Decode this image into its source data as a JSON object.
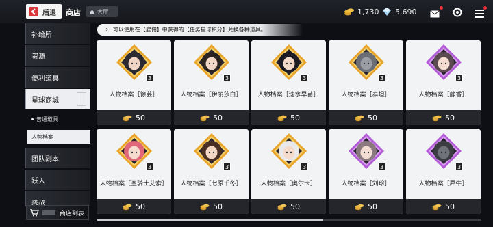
{
  "header": {
    "back_label": "后退",
    "title": "商店",
    "breadcrumb": "大厅",
    "currency_gold": "1,730",
    "currency_crystal": "5,690"
  },
  "sidebar": {
    "items": [
      {
        "label": "补给所"
      },
      {
        "label": "资源"
      },
      {
        "label": "便利道具"
      },
      {
        "label": "星球商城"
      },
      {
        "label": "团队副本"
      },
      {
        "label": "跃入"
      },
      {
        "label": "挑战"
      }
    ],
    "subitems": [
      {
        "label": "普通道具"
      },
      {
        "label": "人物档案"
      }
    ],
    "shop_list_label": "商店列表"
  },
  "notice": "可以使用在【雇佣】中获得的【任务星球积分】兑换各种道具。",
  "colors": {
    "gold_frame": "#e8a42a",
    "purple_frame": "#b35ad6",
    "card_bg": "#f2f3f5",
    "price_bar": "#24262b"
  },
  "products": [
    {
      "name": "人物档案［徐芸］",
      "price": "50",
      "count": "3",
      "rarity": "gold",
      "hair": "#2b2a30",
      "skin": "#f1d5c4"
    },
    {
      "name": "人物档案［伊丽莎白］",
      "price": "50",
      "count": "3",
      "rarity": "gold",
      "hair": "#2a2320",
      "skin": "#f2d7c6"
    },
    {
      "name": "人物档案［速水早苗］",
      "price": "50",
      "count": "3",
      "rarity": "gold",
      "hair": "#1c1a22",
      "skin": "#f3dacb"
    },
    {
      "name": "人物档案［泰坦］",
      "price": "50",
      "count": "3",
      "rarity": "gold",
      "hair": "#6b6e74",
      "skin": "#9a9da3"
    },
    {
      "name": "人物档案［静香］",
      "price": "50",
      "count": "3",
      "rarity": "purple",
      "hair": "#5b4a4f",
      "skin": "#f4dcd0"
    },
    {
      "name": "人物档案［圣骑士艾索］",
      "price": "50",
      "count": "3",
      "rarity": "gold",
      "hair": "#e0667a",
      "skin": "#f6dccf"
    },
    {
      "name": "人物档案［七原千冬］",
      "price": "50",
      "count": "3",
      "rarity": "gold",
      "hair": "#4a2f24",
      "skin": "#f2d5c2"
    },
    {
      "name": "人物档案［奥尔卡］",
      "price": "50",
      "count": "3",
      "rarity": "gold",
      "hair": "#e9e9ec",
      "skin": "#f4dbcc"
    },
    {
      "name": "人物档案［刘珍］",
      "price": "50",
      "count": "3",
      "rarity": "purple",
      "hair": "#8a7a80",
      "skin": "#f4ddd2"
    },
    {
      "name": "人物档案［犀牛］",
      "price": "50",
      "count": "3",
      "rarity": "purple",
      "hair": "#3b3d42",
      "skin": "#6f7278"
    }
  ]
}
